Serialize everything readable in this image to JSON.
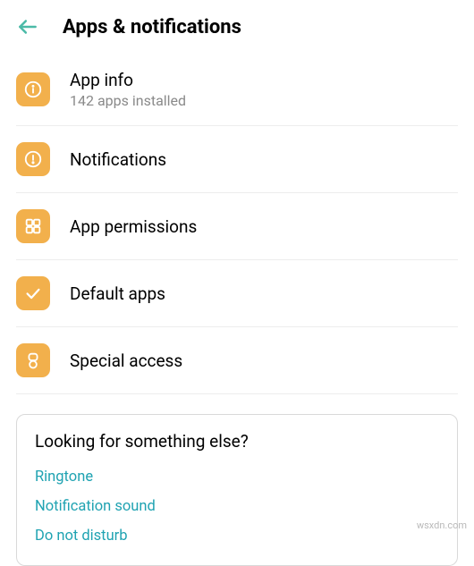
{
  "header": {
    "title": "Apps & notifications"
  },
  "items": [
    {
      "title": "App info",
      "subtitle": "142 apps installed"
    },
    {
      "title": "Notifications"
    },
    {
      "title": "App permissions"
    },
    {
      "title": "Default apps"
    },
    {
      "title": "Special access"
    }
  ],
  "suggestions": {
    "heading": "Looking for something else?",
    "links": [
      "Ringtone",
      "Notification sound",
      "Do not disturb"
    ]
  },
  "watermark": "wsxdn.com",
  "colors": {
    "accent_teal": "#4bbaa7",
    "icon_bg": "#f2b04c",
    "link": "#20a3b2"
  }
}
